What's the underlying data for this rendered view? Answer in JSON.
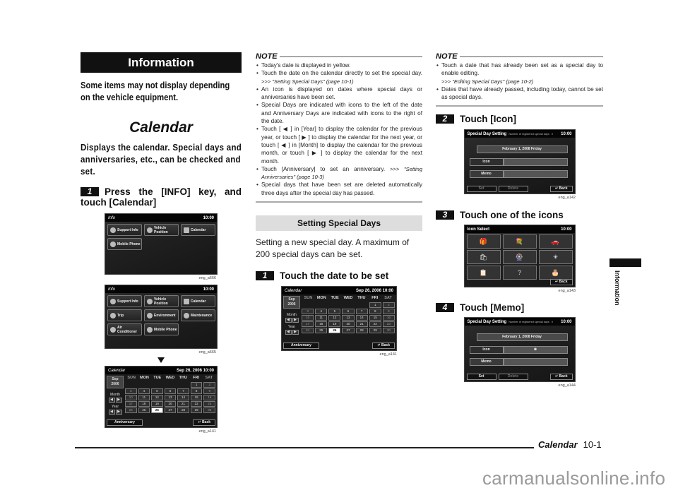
{
  "col1": {
    "banner": "Information",
    "lead": "Some items may not display depending on the vehicle equipment.",
    "heading": "Calendar",
    "desc": "Displays the calendar. Special days and anniversaries, etc., can be checked and set.",
    "step1": {
      "num": "1",
      "text": "Press the [INFO] key, and touch [Calendar]"
    },
    "screen1": {
      "title": "Info",
      "clock": "10:00",
      "tiles": [
        "Support Info",
        "Vehicle Position",
        "Calendar",
        "Mobile Phone"
      ],
      "caption": "eng_a666"
    },
    "screen2": {
      "title": "Info",
      "clock": "10:00",
      "tiles": [
        "Support Info",
        "Vehicle Position",
        "Calendar",
        "Trip",
        "Environment",
        "Maintenance",
        "Air Conditioner",
        "Mobile Phone"
      ],
      "caption": "eng_a665"
    },
    "screen3_caption": "eng_a141"
  },
  "calendar": {
    "title": "Calendar",
    "datetime": "Sep 26, 2006 10:00",
    "month": "Sep",
    "year": "2006",
    "month_label": "Month",
    "year_label": "Year",
    "prev": "◀",
    "next": "▶",
    "dow": [
      "SUN",
      "MON",
      "TUE",
      "WED",
      "THU",
      "FRI",
      "SAT"
    ],
    "days": [
      "",
      "",
      "",
      "",
      "",
      "1",
      "2",
      "3",
      "4",
      "5",
      "6",
      "7",
      "8",
      "9",
      "10",
      "11",
      "12",
      "13",
      "14",
      "15",
      "16",
      "17",
      "18",
      "19",
      "20",
      "21",
      "22",
      "23",
      "24",
      "25",
      "26",
      "27",
      "28",
      "29",
      "30"
    ],
    "today": "26",
    "anniversary": "Anniversary",
    "back": "Back"
  },
  "col2": {
    "note_title": "NOTE",
    "notes": [
      {
        "text": "Today's date is displayed in yellow."
      },
      {
        "text": "Touch the date on the calendar directly to set the special day. ",
        "ref": ">>> \"Setting Special Days\" (page 10-1)"
      },
      {
        "text": "An icon is displayed on dates where special days or anniversaries have been set."
      },
      {
        "text": "Special Days are indicated with icons to the left of the date and Anniversary Days are indicated with icons to the right of the date."
      },
      {
        "text": "Touch [ ◀ ] in [Year] to display the calendar for the previous year, or touch [ ▶ ] to display the calendar for the next year, or touch [ ◀ ] in [Month] to display the calendar for the previous month, or touch [ ▶ ] to display the calendar for the next month."
      },
      {
        "text": "Touch [Anniversary] to set an anniversary. ",
        "ref": ">>> \"Setting Anniversaries\" (page 10-3)"
      },
      {
        "text": "Special days that have been set are deleted automatically three days after the special day has passed."
      }
    ],
    "section_title": "Setting Special Days",
    "section_body": "Setting a new special day. A maximum of 200 special days can be set.",
    "step1": {
      "num": "1",
      "text": "Touch the date to be set"
    },
    "caption": "eng_a141"
  },
  "col3": {
    "note_title": "NOTE",
    "notes": [
      {
        "text": "Touch a date that has already been set as a special day to enable editing.",
        "ref": ">>> \"Editing Special Days\" (page 10-2)"
      },
      {
        "text": "Dates that have already passed, including today, cannot be set as special days."
      }
    ],
    "step2": {
      "num": "2",
      "text": "Touch [Icon]"
    },
    "step3": {
      "num": "3",
      "text": "Touch one of the icons"
    },
    "step4": {
      "num": "4",
      "text": "Touch [Memo]"
    },
    "sd": {
      "title": "Special Day Setting",
      "sub": "Number of registered special days",
      "count": "0",
      "clock": "10:00",
      "date": "February 1, 2008 Friday",
      "icon_label": "Icon",
      "memo_label": "Memo",
      "set": "Set",
      "delete": "Delete",
      "back": "Back"
    },
    "icon_select": {
      "title": "Icon Select",
      "clock": "10:00",
      "icons": [
        "🎁",
        "💐",
        "🚗",
        "🛍",
        "🎡",
        "☀",
        "📋",
        "?",
        "🎂"
      ],
      "back": "Back"
    },
    "captions": [
      "eng_a142",
      "eng_a143",
      "eng_a144"
    ]
  },
  "sidetab": "Information",
  "footer": {
    "section": "Calendar",
    "page": "10-1"
  },
  "watermark": "carmanualsonline.info"
}
